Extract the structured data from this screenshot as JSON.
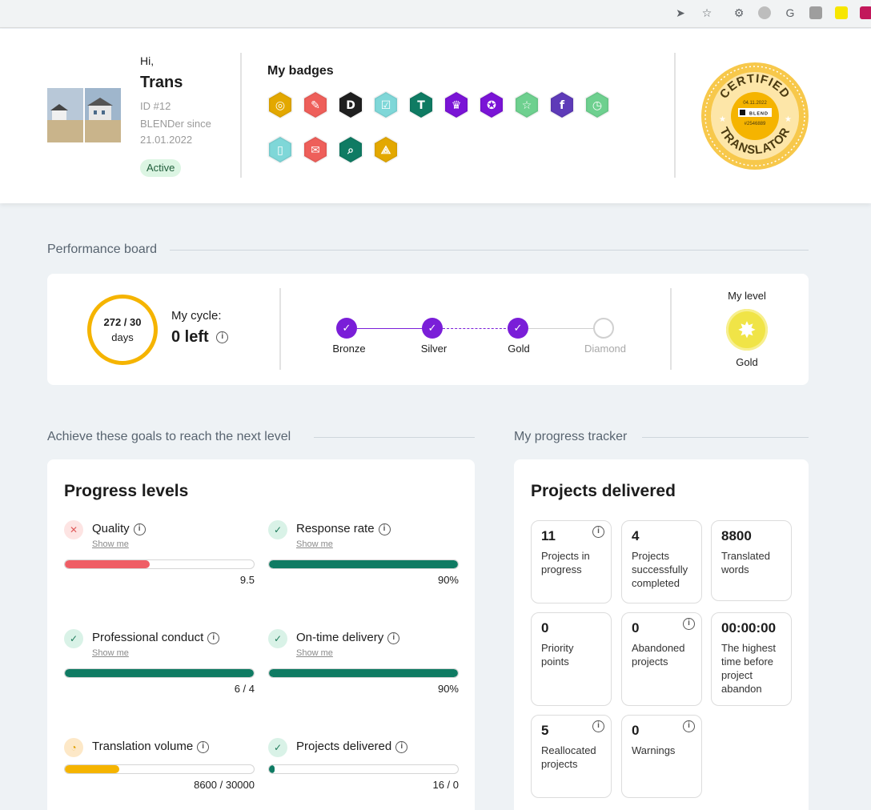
{
  "user": {
    "greeting": "Hi,",
    "name": "Trans",
    "id": "ID #12",
    "since": "BLENDer since 21.01.2022",
    "status": "Active"
  },
  "badges": {
    "title": "My badges",
    "items": [
      {
        "icon": "target-icon",
        "color": "#e3a800"
      },
      {
        "icon": "quill-icon",
        "color": "#ee5f5a"
      },
      {
        "icon": "blend-d-icon",
        "color": "#1f1f1f"
      },
      {
        "icon": "checkbox-icon",
        "color": "#7fd7d8"
      },
      {
        "icon": "text-format-icon",
        "color": "#0f7b63"
      },
      {
        "icon": "crown-icon",
        "color": "#7a14d6"
      },
      {
        "icon": "star-seal-icon",
        "color": "#7a14d6"
      },
      {
        "icon": "star-icon",
        "color": "#6ed08f"
      },
      {
        "icon": "facebook-icon",
        "color": "#5e3bb8"
      },
      {
        "icon": "stopwatch-icon",
        "color": "#6ed08f"
      },
      {
        "icon": "phone-icon",
        "color": "#7fd7d8"
      },
      {
        "icon": "speech-bubble-icon",
        "color": "#ee5f5a"
      },
      {
        "icon": "magnifier-icon",
        "color": "#0f7b63"
      },
      {
        "icon": "network-icon",
        "color": "#e3a800"
      }
    ]
  },
  "certificate": {
    "top_text": "CERTIFIED",
    "bottom_text": "TRANSLATOR",
    "date": "04.11.2022",
    "brand": "BLEND",
    "number": "#2546889",
    "colors": {
      "outer": "#f7c84b",
      "inner": "#f5b400",
      "light": "#fde6a8"
    }
  },
  "performance": {
    "section_title": "Performance board",
    "cycle_ratio": "272 / 30",
    "cycle_unit": "days",
    "cycle_label": "My cycle:",
    "cycle_left": "0 left",
    "steps": [
      {
        "label": "Bronze",
        "done": true
      },
      {
        "label": "Silver",
        "done": true
      },
      {
        "label": "Gold",
        "done": true
      },
      {
        "label": "Diamond",
        "done": false
      }
    ],
    "level_title": "My level",
    "level_name": "Gold"
  },
  "goals": {
    "section_title": "Achieve these goals to reach the next level",
    "card_title": "Progress levels",
    "show_me": "Show me",
    "metrics": [
      {
        "label": "Quality",
        "status": "fail",
        "value": "9.5",
        "fraction": 0.45,
        "color": "#ef5d65"
      },
      {
        "label": "Response rate",
        "status": "pass",
        "value": "90%",
        "fraction": 1.0,
        "color": "#0f7b63"
      },
      {
        "label": "Professional conduct",
        "status": "pass",
        "value": "6 / 4",
        "fraction": 1.0,
        "color": "#0f7b63"
      },
      {
        "label": "On-time delivery",
        "status": "pass",
        "value": "90%",
        "fraction": 1.0,
        "color": "#0f7b63"
      },
      {
        "label": "Translation volume",
        "status": "pending",
        "value": "8600 / 30000",
        "fraction": 0.287,
        "color": "#f5b400"
      },
      {
        "label": "Projects delivered",
        "status": "pass",
        "value": "16 / 0",
        "fraction": 0.03,
        "color": "#0f7b63"
      }
    ]
  },
  "tracker": {
    "section_title": "My progress tracker",
    "card_title": "Projects delivered",
    "tiles": [
      {
        "number": "11",
        "label": "Projects in progress",
        "info": true
      },
      {
        "number": "4",
        "label": "Projects successfully completed",
        "info": false
      },
      {
        "number": "8800",
        "label": "Translated words",
        "info": false
      },
      {
        "number": "0",
        "label": "Priority points",
        "info": false
      },
      {
        "number": "0",
        "label": "Abandoned projects",
        "info": true
      },
      {
        "number": "00:00:00",
        "label": "The highest time before project abandon",
        "info": false
      },
      {
        "number": "5",
        "label": "Reallocated projects",
        "info": true
      },
      {
        "number": "0",
        "label": "Warnings",
        "info": true
      }
    ]
  }
}
